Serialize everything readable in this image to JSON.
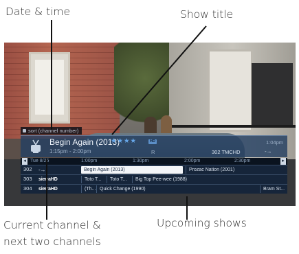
{
  "callouts": {
    "date_time": "Date & time",
    "show_title": "Show title",
    "current_channel_line1": "Current channel &",
    "current_channel_line2": "next two channels",
    "upcoming_shows": "Upcoming shows"
  },
  "overlay": {
    "sort_label": "sort (channel number)",
    "info": {
      "title": "Begin Again (2013)",
      "stars": "★★★★",
      "hd_badge": "HD",
      "time": "1:15pm - 2:00pm",
      "rated": "R",
      "channel_call": "302 TMCHD",
      "clock": "1:04pm",
      "channel_arrow": "-→"
    },
    "guide": {
      "date": "Tue 8/25",
      "times": [
        "1:00pm",
        "1:30pm",
        "2:00pm",
        "2:30pm"
      ],
      "rows": [
        {
          "number": "302",
          "logo": "-→",
          "programs": [
            "Begin Again (2013)",
            "Prozac Nation (2001)"
          ]
        },
        {
          "number": "303",
          "logo": "sierraHD",
          "programs": [
            "Toto T...",
            "Toto T...",
            "Big Top Pee-wee (1988)"
          ]
        },
        {
          "number": "304",
          "logo": "sierraHD",
          "programs": [
            "(Th...",
            "Quick Change (1990)",
            "Bram St..."
          ]
        }
      ]
    }
  },
  "colors": {
    "panel": "#244062",
    "selected": "#f3f5f8",
    "stars": "#67a8ea"
  }
}
